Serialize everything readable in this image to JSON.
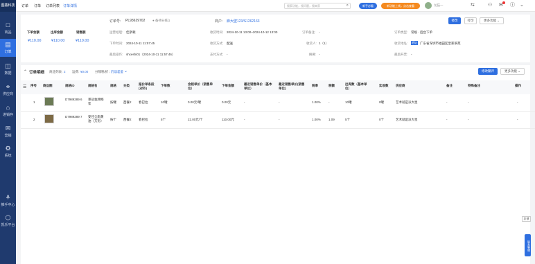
{
  "sidebar": {
    "logo": "图鑫科技",
    "items": [
      {
        "label": "商品",
        "icon": "□"
      },
      {
        "label": "订单",
        "icon": "▤"
      },
      {
        "label": "数据",
        "icon": "◫"
      },
      {
        "label": "供应商",
        "icon": "⚭"
      },
      {
        "label": "进销存",
        "icon": "⌂"
      },
      {
        "label": "营销",
        "icon": "✉"
      },
      {
        "label": "系统",
        "icon": "⚙"
      },
      {
        "label": "推手中心",
        "icon": "⚘"
      },
      {
        "label": "凯乐平台",
        "icon": "⬡"
      }
    ]
  },
  "topbar": {
    "tabs": [
      "订单",
      "订单",
      "订单列表",
      "订单详情"
    ],
    "search_placeholder": "搜索功能，搜问题，搜商家",
    "pill_new": "新手必看",
    "pill_promo": "新功能上线，点击查看",
    "user_name": "龙猫一"
  },
  "order": {
    "summary": [
      {
        "label": "下单金额",
        "value": "¥110.00"
      },
      {
        "label": "出库金额",
        "value": "¥110.00"
      },
      {
        "label": "销售额",
        "value": "¥110.00"
      }
    ],
    "order_no_label": "订单号:",
    "order_no": "PL93629702",
    "follow_link": "● 备待分拣()",
    "merchant_label": "商户:",
    "merchant_value": "麻大壁123/S1262163",
    "edit_label": "修改",
    "print_label": "打印",
    "more_label": "更多功能",
    "fields": [
      {
        "label": "运营经理:",
        "value": "佳斯顿"
      },
      {
        "label": "收货时间:",
        "value": "2024-10-11 13:00~2024-10-12 13:00"
      },
      {
        "label": "订单备注:",
        "value": "-"
      },
      {
        "label": "订单类型:",
        "value": "常规 · 后台下单"
      },
      {
        "label": "下单时间:",
        "value": "2024-10-11 11:57:45"
      },
      {
        "label": "收货方式:",
        "value": "配送"
      },
      {
        "label": "收货人:",
        "value": "1（1）"
      },
      {
        "label": "收货地址:",
        "value": "广东省深圳市福田区皇家翠苑"
      },
      {
        "label": "最后操作:",
        "value": "shceshi01（2024-10-11 11:57:46）"
      },
      {
        "label": "支付方式:",
        "value": "-"
      },
      {
        "label": "摘要:",
        "value": "-"
      },
      {
        "label": "最后开票:",
        "value": "-"
      }
    ],
    "address_tag": "地址"
  },
  "detail": {
    "title": "订单明细",
    "count_label": "商品列表:",
    "count_value": "2",
    "sum_label": "运费:",
    "sum_value": "¥0.00",
    "split_label": "分隔税/折：",
    "split_link": "仍误差鉴",
    "batch_modify": "修改聚评",
    "more": "更多功能",
    "columns": [
      "序号",
      "商品图",
      "规格ID",
      "规格名",
      "规格",
      "分类",
      "报价单条段(对外)",
      "下单数",
      "含税单价（销售单位）",
      "下单金额",
      "最近销售单价（基本单位）",
      "最近销售单价(销售单位)",
      "税率",
      "税额",
      "出库数（基本单位）",
      "实收数",
      "供应商",
      "备注",
      "特殊备注",
      "操作"
    ],
    "rows": [
      {
        "seq": "1",
        "sku": "D7989289 6",
        "name": "莱冠金牌椰浆",
        "spec": "按罐",
        "cat": "西餐2",
        "quote": "春巴拉",
        "qty": "10罐",
        "price": "0.00元/罐",
        "amount": "0.00元",
        "recent1": "-",
        "recent2": "-",
        "tax": "1.00%",
        "tax_amt": "-",
        "out": "10罐",
        "recv": "0罐",
        "supplier": "艺术就是派大星",
        "remark": "-",
        "special": "-",
        "op": "-"
      },
      {
        "seq": "2",
        "sku": "D7989289 7",
        "name": "安佳全脂黄油（方形）",
        "spec": "按个",
        "cat": "西餐2",
        "quote": "春巴拉",
        "qty": "5个",
        "price": "22.00元/个",
        "amount": "110.00元",
        "recent1": "-",
        "recent2": "-",
        "tax": "1.00%",
        "tax_amt": "1.09",
        "out": "5个",
        "recv": "0个",
        "supplier": "艺术就是派大星",
        "remark": "-",
        "special": "-",
        "op": "-"
      }
    ]
  },
  "floating": {
    "feedback": "反馈",
    "service": "联系客服"
  },
  "colors": {
    "primary": "#2f6fe0",
    "sidebar": "#1f3a6e",
    "orange": "#f58a1f"
  }
}
